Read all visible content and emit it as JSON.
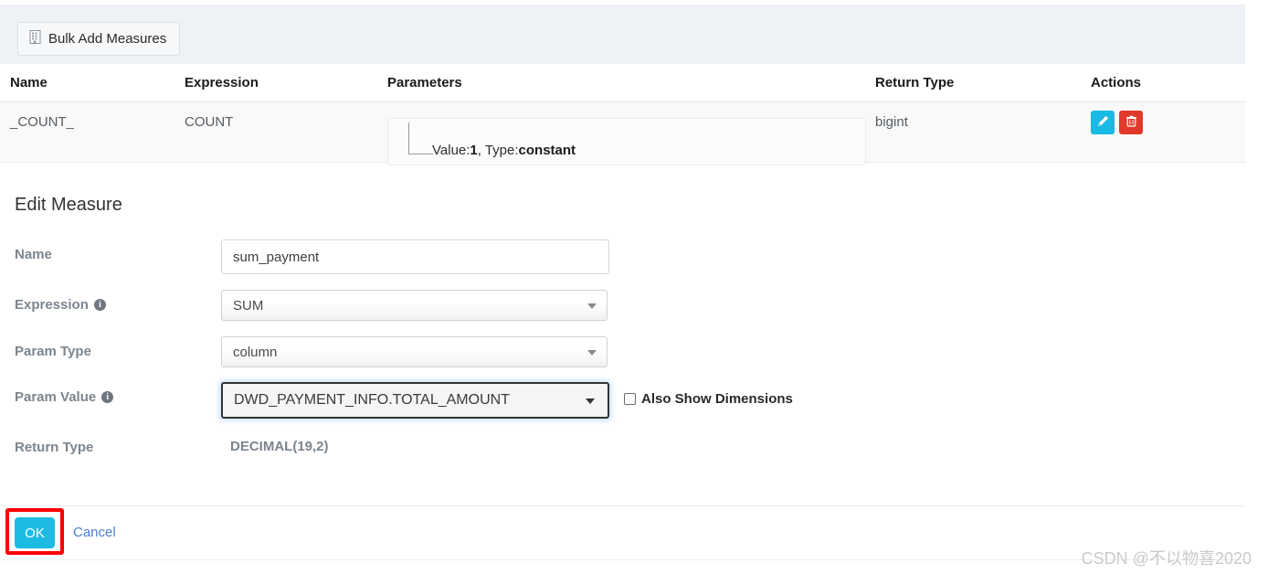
{
  "toolbar": {
    "bulk_add_label": "Bulk Add Measures",
    "bulk_add_icon": "grid-building-icon",
    "background_color": "#eef1f5"
  },
  "table": {
    "columns": [
      "Name",
      "Expression",
      "Parameters",
      "Return Type",
      "Actions"
    ],
    "rows": [
      {
        "name": "_COUNT_",
        "expression": "COUNT",
        "parameter_prefix": "Value:",
        "parameter_value": "1",
        "parameter_sep": ", Type:",
        "parameter_type": "constant",
        "return_type": "bigint",
        "actions": [
          {
            "name": "edit-button",
            "icon": "pencil-icon",
            "color": "#19bae4"
          },
          {
            "name": "delete-button",
            "icon": "trash-icon",
            "color": "#e0392c"
          }
        ]
      }
    ]
  },
  "form": {
    "title": "Edit Measure",
    "fields": {
      "name": {
        "label": "Name",
        "value": "sum_payment",
        "placeholder": "Name"
      },
      "expression": {
        "label": "Expression",
        "has_info": true,
        "value": "SUM"
      },
      "param_type": {
        "label": "Param Type",
        "has_info": false,
        "value": "column"
      },
      "param_value": {
        "label": "Param Value",
        "has_info": true,
        "value": "DWD_PAYMENT_INFO.TOTAL_AMOUNT",
        "focused": true
      },
      "return_type": {
        "label": "Return Type",
        "value": "DECIMAL(19,2)"
      }
    },
    "checkbox": {
      "label": "Also Show Dimensions",
      "checked": false
    }
  },
  "footer": {
    "ok_label": "OK",
    "cancel_label": "Cancel",
    "ok_color": "#1dbbe3",
    "highlight_color": "#fe0000"
  },
  "watermark": "CSDN @不以物喜2020"
}
